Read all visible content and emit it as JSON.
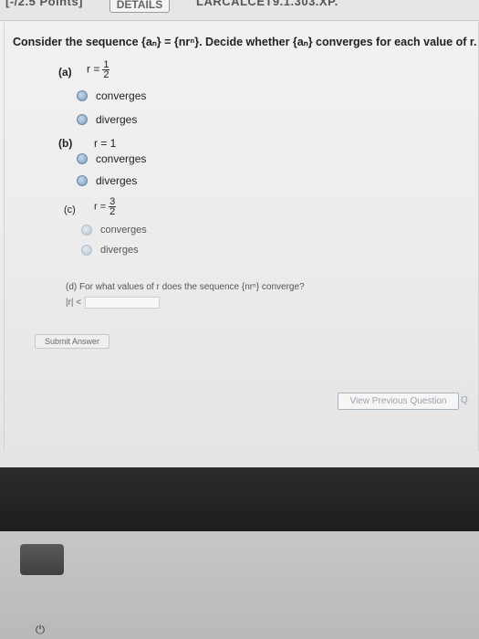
{
  "header": {
    "points_label": "[-/2.5 Points]",
    "details_label": "DETAILS",
    "problem_id": "LARCALCET9.1.303.XP."
  },
  "question": {
    "text": "Consider the sequence {aₙ} = {nrⁿ}. Decide whether {aₙ} converges for each value of r."
  },
  "parts": [
    {
      "label": "(a)",
      "r_prefix": "r =",
      "r_num": "1",
      "r_den": "2",
      "options": [
        "converges",
        "diverges"
      ]
    },
    {
      "label": "(b)",
      "r_prefix": "r = 1",
      "options": [
        "converges",
        "diverges"
      ]
    },
    {
      "label": "(c)",
      "r_prefix": "r =",
      "r_num": "3",
      "r_den": "2",
      "options": [
        "converges",
        "diverges"
      ]
    }
  ],
  "part_d": {
    "text": "(d) For what values of r does the sequence {nrⁿ} converge?",
    "abs_label": "|r| <",
    "input_value": ""
  },
  "buttons": {
    "submit": "Submit Answer",
    "previous": "View Previous Question",
    "next": "Q"
  },
  "icons": {
    "power": "power-icon"
  }
}
